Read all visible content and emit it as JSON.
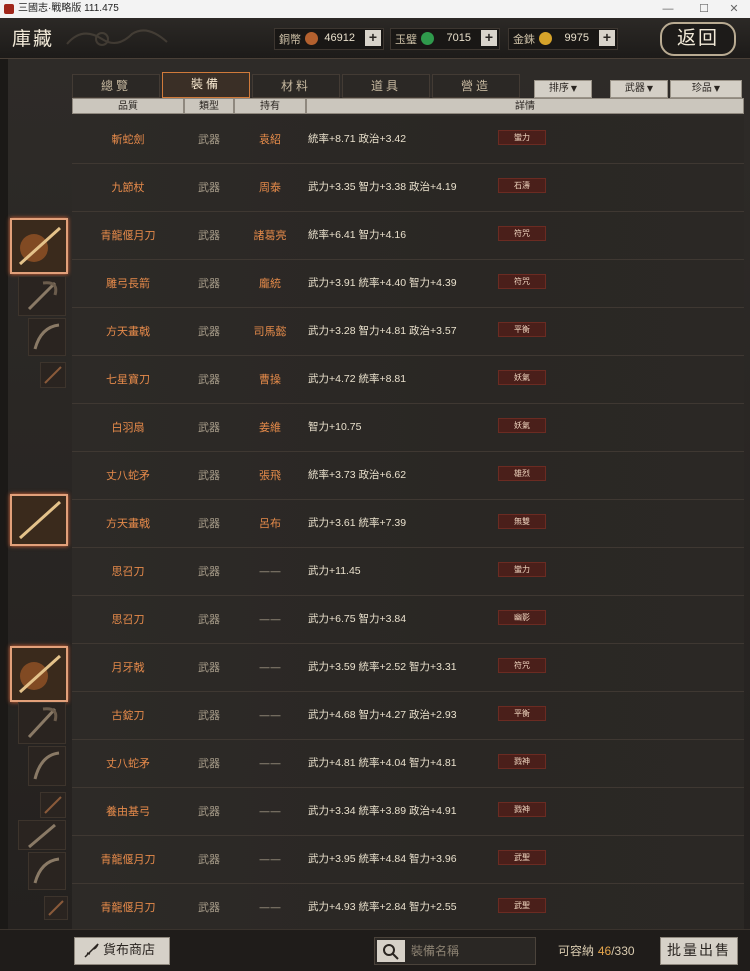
{
  "window": {
    "title": "三國志·戰略版 111.475",
    "controls": [
      "—",
      "☐",
      "✕"
    ]
  },
  "header": {
    "title": "庫藏",
    "back_label": "返回",
    "currencies": [
      {
        "name": "銅幣",
        "amount": "46912",
        "color": "#b3602e",
        "icon": "copper-coin-icon"
      },
      {
        "name": "玉璧",
        "amount": "7015",
        "color": "#2f9a4c",
        "icon": "jade-icon"
      },
      {
        "name": "金銖",
        "amount": "9975",
        "color": "#d6a32a",
        "icon": "gold-coin-icon"
      }
    ],
    "plus": "+"
  },
  "tabs": [
    {
      "label": "總覽",
      "active": false
    },
    {
      "label": "裝備",
      "active": true
    },
    {
      "label": "材料",
      "active": false
    },
    {
      "label": "道具",
      "active": false
    },
    {
      "label": "營造",
      "active": false
    }
  ],
  "filters": [
    {
      "label": "排序"
    },
    {
      "label": "武器"
    },
    {
      "label": "珍品"
    }
  ],
  "table": {
    "headers": [
      "品質",
      "類型",
      "持有",
      "詳情"
    ],
    "rows": [
      {
        "name": "斬蛇劍",
        "type": "武器",
        "owner": "袁紹",
        "detail": "統率+8.71  政治+3.42",
        "skill": "蠻力"
      },
      {
        "name": "九節杖",
        "type": "武器",
        "owner": "周泰",
        "detail": "武力+3.35  智力+3.38  政治+4.19",
        "skill": "石濤"
      },
      {
        "name": "青龍偃月刀",
        "type": "武器",
        "owner": "諸葛亮",
        "detail": "統率+6.41  智力+4.16",
        "skill": "符咒"
      },
      {
        "name": "雕弓長箭",
        "type": "武器",
        "owner": "龐統",
        "detail": "武力+3.91  統率+4.40  智力+4.39",
        "skill": "符咒"
      },
      {
        "name": "方天畫戟",
        "type": "武器",
        "owner": "司馬懿",
        "detail": "武力+3.28  智力+4.81  政治+3.57",
        "skill": "平衡"
      },
      {
        "name": "七星寶刀",
        "type": "武器",
        "owner": "曹操",
        "detail": "武力+4.72  統率+8.81",
        "skill": "妖氣"
      },
      {
        "name": "白羽扇",
        "type": "武器",
        "owner": "姜維",
        "detail": "智力+10.75",
        "skill": "妖氣"
      },
      {
        "name": "丈八蛇矛",
        "type": "武器",
        "owner": "張飛",
        "detail": "統率+3.73  政治+6.62",
        "skill": "雄烈"
      },
      {
        "name": "方天畫戟",
        "type": "武器",
        "owner": "呂布",
        "detail": "武力+3.61  統率+7.39",
        "skill": "無雙"
      },
      {
        "name": "思召刀",
        "type": "武器",
        "owner": "——",
        "detail": "武力+11.45",
        "skill": "蠻力"
      },
      {
        "name": "思召刀",
        "type": "武器",
        "owner": "——",
        "detail": "武力+6.75  智力+3.84",
        "skill": "幽影"
      },
      {
        "name": "月牙戟",
        "type": "武器",
        "owner": "——",
        "detail": "武力+3.59  統率+2.52  智力+3.31",
        "skill": "符咒"
      },
      {
        "name": "古錠刀",
        "type": "武器",
        "owner": "——",
        "detail": "武力+4.68  智力+4.27  政治+2.93",
        "skill": "平衡"
      },
      {
        "name": "丈八蛇矛",
        "type": "武器",
        "owner": "——",
        "detail": "武力+4.81  統率+4.04  智力+4.81",
        "skill": "戮神"
      },
      {
        "name": "養由基弓",
        "type": "武器",
        "owner": "——",
        "detail": "武力+3.34  統率+3.89  政治+4.91",
        "skill": "戮神"
      },
      {
        "name": "青龍偃月刀",
        "type": "武器",
        "owner": "——",
        "detail": "武力+3.95  統率+4.84  智力+3.96",
        "skill": "武聖"
      },
      {
        "name": "青龍偃月刀",
        "type": "武器",
        "owner": "——",
        "detail": "武力+4.93  統率+2.84  智力+2.55",
        "skill": "武聖"
      }
    ]
  },
  "footer": {
    "store_label": "貨布商店",
    "search_placeholder": "裝備名稱",
    "capacity_label": "可容納",
    "capacity_current": "46",
    "capacity_total": "/330",
    "bulk_sell_label": "批量出售"
  }
}
